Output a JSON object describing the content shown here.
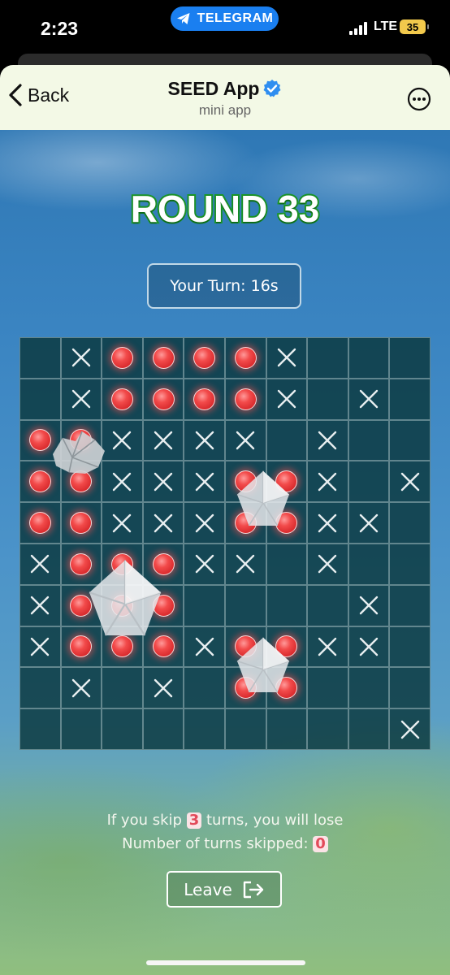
{
  "status_bar": {
    "time": "2:23",
    "app_pill": "TELEGRAM",
    "network": "LTE",
    "battery": "35"
  },
  "header": {
    "back_label": "Back",
    "title": "SEED App",
    "subtitle": "mini app"
  },
  "game": {
    "round_title": "ROUND 33",
    "turn_label": "Your Turn: 16s",
    "board": {
      "rows": 10,
      "cols": 10,
      "grid": [
        "_X....X___",
        "_X....X_X_",
        "..XXXX_X__",
        "..XXX..X_X",
        "..XXX..XX_",
        "X...XX_X__",
        "X...____X_",
        "X...X..XX_",
        "_X_X_..___",
        "_________X"
      ],
      "legend": {
        ".": "hit",
        "X": "miss",
        "_": "empty"
      }
    },
    "skip_rule_prefix": "If you skip ",
    "skip_limit": "3",
    "skip_rule_suffix": " turns, you will lose",
    "skipped_prefix": "Number of turns skipped: ",
    "skipped_count": "0",
    "leave_label": "Leave"
  },
  "icons": {
    "back": "chevron-left-icon",
    "verified": "verified-badge-icon",
    "more": "more-options-icon",
    "telegram": "telegram-plane-icon",
    "leave": "exit-icon"
  },
  "colors": {
    "hit": "#e62c2c",
    "title_stroke": "#1c9a2a",
    "header_bg": "#f3f9e6",
    "telegram_blue": "#1a7ff0"
  }
}
